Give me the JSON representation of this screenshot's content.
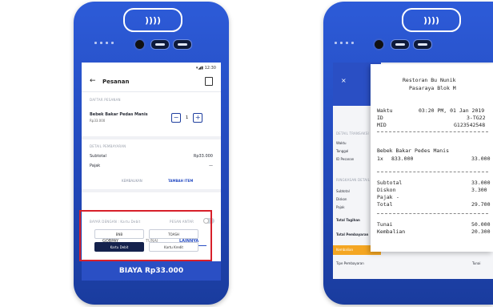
{
  "device1": {
    "status_time": "12:30",
    "header_title": "Pesanan",
    "section_order": "DAFTAR PESANAN",
    "item_name": "Bebek Bakar Pedas Manis",
    "item_price": "Rp33.000",
    "item_qty": "1",
    "minus_label": "−",
    "plus_label": "+",
    "section_payment": "DETAIL PEMBAYARAN",
    "subtotal_label": "Subtotal",
    "subtotal_value": "Rp33.000",
    "tax_label": "Pajak",
    "tax_value": "—",
    "link_left": "KEMBALIKAN",
    "link_right": "TAMBAH ITEM",
    "pay_with_label": "BAYAR DENGAN : Kartu Debit",
    "cashier_toggle_label": "PESAN ANTAR",
    "tabs": [
      "GOBPAY",
      "TUNAI",
      "LAINNYA"
    ],
    "methods": [
      "BNB",
      "TOASH",
      "Kartu Debit",
      "Kartu Kredit"
    ],
    "pay_button": "BIAYA Rp33.000",
    "nfc_label": "))))"
  },
  "device2": {
    "back_icon_label": "×",
    "left_labels": [
      "DETAIL TRANSAKSI",
      "Waktu",
      "Tanggal",
      "ID Pesanan",
      "RINGKASAN DETAIL",
      "Subtotal",
      "Diskon",
      "Pajak",
      "Total Tagihan",
      "Total Pembayaran",
      "Kembalian",
      "Tipe Pembayaran"
    ],
    "left_value_tunai": "Tunai",
    "receipt": {
      "store_name": "Restoran Bu Nunik",
      "store_location": "Pasaraya Blok M",
      "time_label": "Waktu",
      "time_value": "03:20 PM, 01 Jan 2019",
      "id_label": "ID",
      "id_value": "3-TG22",
      "mid_label": "MID",
      "mid_value": "G123542548",
      "item_name": "Bebek Bakar Pedes Manis",
      "item_qty": "1x",
      "item_unit": "833.000",
      "item_total": "33.000",
      "subtotal_label": "Subtotal",
      "subtotal_value": "33.000",
      "discount_label": "Diskon",
      "discount_value": "3.300",
      "tax_label": "Pajak",
      "tax_value": "-",
      "total_label": "Total",
      "total_value": "29.700",
      "cash_label": "Tunai",
      "cash_value": "50.000",
      "change_label": "Kembalian",
      "change_value": "20.300"
    }
  },
  "colors": {
    "brand_blue": "#2a4fc4",
    "highlight_red": "#d8202a",
    "accent_orange": "#f4a623",
    "dark_navy": "#15224d"
  }
}
